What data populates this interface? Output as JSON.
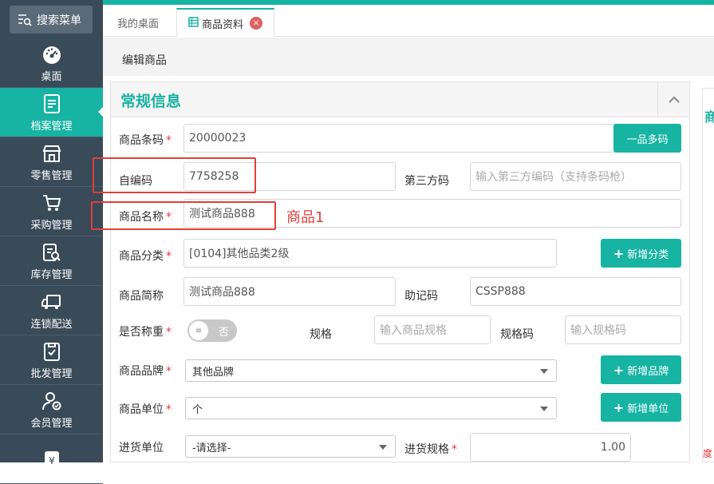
{
  "sidebar": {
    "search_label": "搜索菜单",
    "items": [
      {
        "label": "桌面",
        "icon": "dashboard-icon"
      },
      {
        "label": "档案管理",
        "icon": "archive-icon",
        "active": true
      },
      {
        "label": "零售管理",
        "icon": "store-icon"
      },
      {
        "label": "采购管理",
        "icon": "cart-icon"
      },
      {
        "label": "库存管理",
        "icon": "inventory-icon"
      },
      {
        "label": "连锁配送",
        "icon": "truck-icon"
      },
      {
        "label": "批发管理",
        "icon": "wholesale-icon"
      },
      {
        "label": "会员管理",
        "icon": "member-icon"
      },
      {
        "label": "",
        "icon": "money-icon"
      }
    ]
  },
  "tabs": {
    "home": "我的桌面",
    "active": "商品资料",
    "close": "×"
  },
  "page": {
    "subtitle": "编辑商品",
    "panel_title": "常规信息",
    "right_panel_title": "商",
    "right_panel_tail": "度"
  },
  "form": {
    "barcode": {
      "label": "商品条码",
      "value": "20000023",
      "button": "一品多码"
    },
    "self_code": {
      "label": "自编码",
      "value": "7758258"
    },
    "third_code": {
      "label": "第三方码",
      "placeholder": "输入第三方编码（支持条码枪）"
    },
    "name": {
      "label": "商品名称",
      "value": "测试商品888"
    },
    "category": {
      "label": "商品分类",
      "value": "[0104]其他品类2级",
      "button": "新增分类"
    },
    "short_name": {
      "label": "商品简称",
      "value": "测试商品888"
    },
    "mnemonic": {
      "label": "助记码",
      "value": "CSSP888"
    },
    "weighing": {
      "label": "是否称重",
      "value": "否"
    },
    "spec": {
      "label": "规格",
      "placeholder": "输入商品规格"
    },
    "spec_code": {
      "label": "规格码",
      "placeholder": "输入规格码"
    },
    "brand": {
      "label": "商品品牌",
      "value": "其他品牌",
      "button": "新增品牌"
    },
    "unit": {
      "label": "商品单位",
      "value": "个",
      "button": "新增单位"
    },
    "purchase_unit": {
      "label": "进货单位",
      "value": "-请选择-"
    },
    "purchase_spec": {
      "label": "进货规格",
      "value": "1.00"
    }
  },
  "annotation": {
    "text": "商品1"
  },
  "colors": {
    "accent": "#17b3a3",
    "sidebar": "#394a59",
    "required": "#e33",
    "annotation": "#e0403a"
  }
}
